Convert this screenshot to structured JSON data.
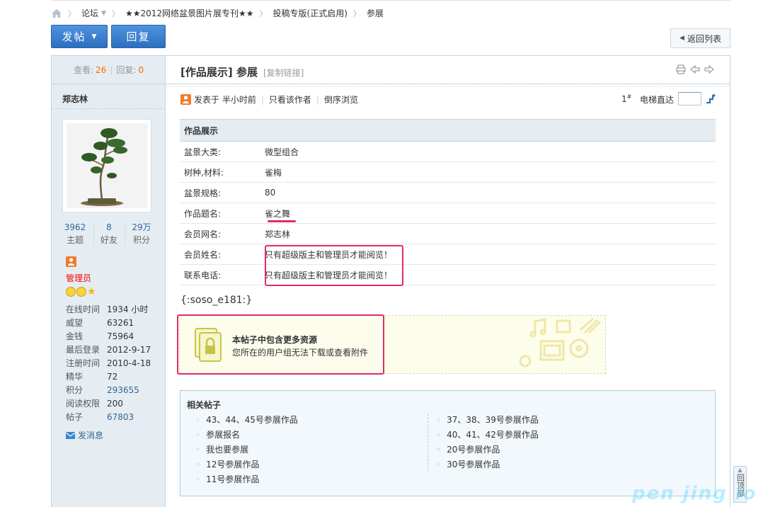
{
  "breadcrumb": {
    "forum": "论坛",
    "board": "★★2012网络盆景图片展专刊★★",
    "sub": "投稿专版(正式启用)",
    "current": "参展"
  },
  "toolbar": {
    "post": "发帖",
    "reply": "回复",
    "return": "返回列表"
  },
  "stats": {
    "views_label": "查看:",
    "views": "26",
    "replies_label": "回复:",
    "replies": "0"
  },
  "author": {
    "name": "郑志林",
    "topics": "3962",
    "topics_label": "主题",
    "friends": "8",
    "friends_label": "好友",
    "points": "29万",
    "points_label": "积分",
    "group": "管理员",
    "send_msg": "发消息",
    "profile": [
      {
        "k": "在线时间",
        "v": "1934 小时"
      },
      {
        "k": "威望",
        "v": "63261"
      },
      {
        "k": "金钱",
        "v": "75964"
      },
      {
        "k": "最后登录",
        "v": "2012-9-17"
      },
      {
        "k": "注册时间",
        "v": "2010-4-18"
      },
      {
        "k": "精华",
        "v": "72"
      },
      {
        "k": "积分",
        "v": "293655"
      },
      {
        "k": "阅读权限",
        "v": "200"
      },
      {
        "k": "帖子",
        "v": "67803"
      }
    ]
  },
  "post": {
    "category": "[作品展示]",
    "title": "参展",
    "copy_link": "[复制链接]",
    "posted": "发表于 半小时前",
    "only_author": "只看该作者",
    "reverse": "倒序浏览",
    "floor": "1",
    "floor_mark": "#",
    "elevator": "电梯直达"
  },
  "table": {
    "header": "作品展示",
    "rows": [
      {
        "k": "盆景大类:",
        "v": "微型组合"
      },
      {
        "k": "树种,材料:",
        "v": "雀梅"
      },
      {
        "k": "盆景规格:",
        "v": "80"
      },
      {
        "k": "作品题名:",
        "v": "雀之舞"
      },
      {
        "k": "会员网名:",
        "v": "郑志林"
      },
      {
        "k": "会员姓名:",
        "v": "只有超级版主和管理员才能阅览！"
      },
      {
        "k": "联系电话:",
        "v": "只有超级版主和管理员才能阅览！"
      }
    ]
  },
  "soso": "{:soso_e181:}",
  "locked": {
    "title": "本帖子中包含更多资源",
    "subtitle": "您所在的用户组无法下载或查看附件"
  },
  "related": {
    "title": "相关帖子",
    "left": [
      "43、44、45号参展作品",
      "参展报名",
      "我也要参展",
      "12号参展作品",
      "11号参展作品"
    ],
    "right": [
      "37、38、39号参展作品",
      "40、41、42号参展作品",
      "20号参展作品",
      "30号参展作品"
    ]
  },
  "back_top": "回顶部",
  "watermark": "pen jing lo run",
  "colors": {
    "accent": "#2c6fc0",
    "link": "#336699",
    "admin": "#ff0000",
    "count": "#ff6600",
    "annotation": "#e22a6e"
  }
}
